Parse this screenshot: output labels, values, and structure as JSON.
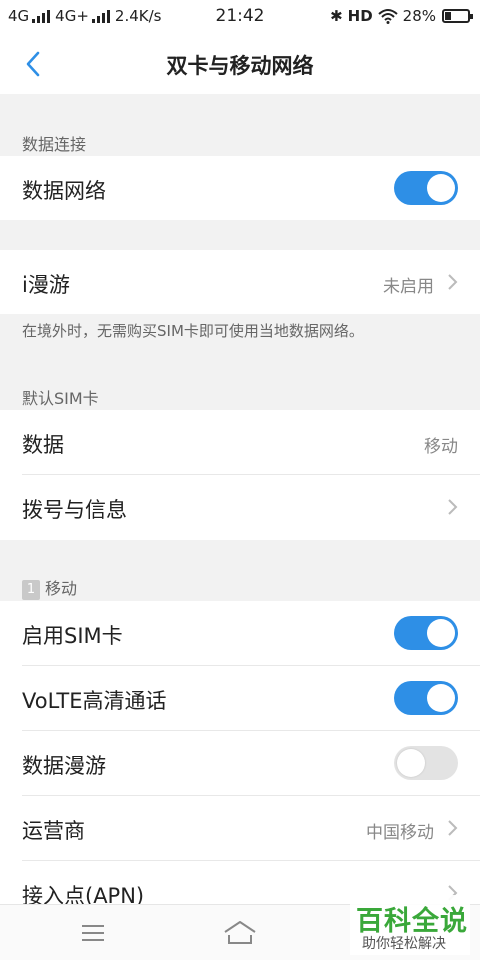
{
  "status_bar": {
    "network1": "4G",
    "network2": "4G+",
    "speed": "2.4K/s",
    "time": "21:42",
    "hd_label": "HD",
    "battery_percent": "28%",
    "battery_level": 0.28
  },
  "header": {
    "title": "双卡与移动网络"
  },
  "sections": {
    "data_connection": {
      "label": "数据连接",
      "data_network": {
        "label": "数据网络",
        "enabled": true
      }
    },
    "roaming": {
      "label": "i漫游",
      "value": "未启用",
      "hint": "在境外时，无需购买SIM卡即可使用当地数据网络。"
    },
    "default_sim": {
      "label": "默认SIM卡",
      "data": {
        "label": "数据",
        "value": "移动"
      },
      "dial_sms": {
        "label": "拨号与信息"
      }
    },
    "sim1": {
      "badge": "1",
      "label": "移动",
      "enable_sim": {
        "label": "启用SIM卡",
        "enabled": true
      },
      "volte": {
        "label": "VoLTE高清通话",
        "enabled": true
      },
      "data_roaming": {
        "label": "数据漫游",
        "enabled": false
      },
      "carrier": {
        "label": "运营商",
        "value": "中国移动"
      },
      "apn": {
        "label": "接入点(APN)"
      }
    }
  },
  "watermark": {
    "main": "百科全说",
    "sub": "助你轻松解决"
  },
  "colors": {
    "accent": "#2e8fe6",
    "toggle_off": "#e3e3e3",
    "background": "#f2f2f2",
    "watermark_green": "#3aa83a"
  }
}
